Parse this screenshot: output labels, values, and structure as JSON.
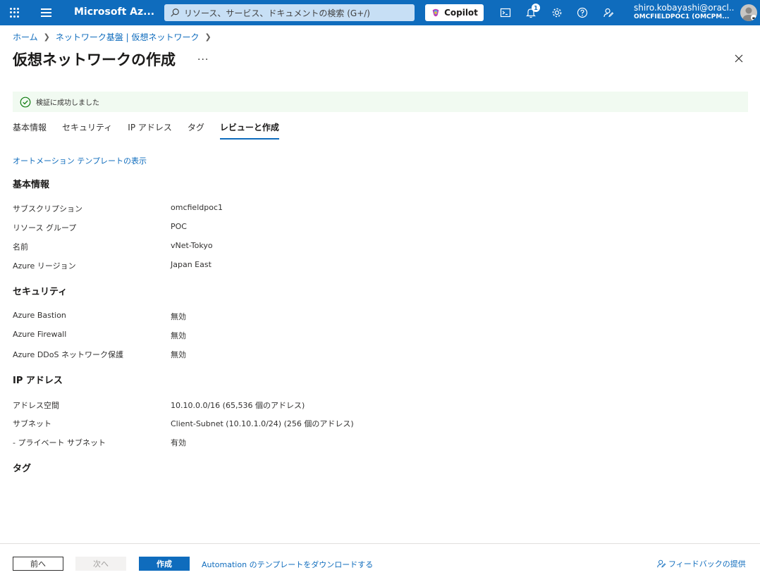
{
  "topbar": {
    "brand": "Microsoft Az...",
    "search_placeholder": "リソース、サービス、ドキュメントの検索 (G+/)",
    "copilot_label": "Copilot",
    "notification_count": "1",
    "account_user": "shiro.kobayashi@oracl...",
    "account_tenant": "OMCFIELDPOC1 (OMCPM...",
    "accent_color": "#0f6cbd"
  },
  "breadcrumb": {
    "home": "ホーム",
    "parent": "ネットワーク基盤 | 仮想ネットワーク"
  },
  "page": {
    "title": "仮想ネットワークの作成",
    "more": "...",
    "banner_text": "検証に成功しました"
  },
  "tabs": [
    {
      "label": "基本情報"
    },
    {
      "label": "セキュリティ"
    },
    {
      "label": "IP アドレス"
    },
    {
      "label": "タグ"
    },
    {
      "label": "レビューと作成"
    }
  ],
  "automation_link": "オートメーション テンプレートの表示",
  "sections": {
    "basics": {
      "title": "基本情報",
      "rows": [
        {
          "label": "サブスクリプション",
          "value": "omcfieldpoc1"
        },
        {
          "label": "リソース グループ",
          "value": "POC"
        },
        {
          "label": "名前",
          "value": "vNet-Tokyo"
        },
        {
          "label": "Azure リージョン",
          "value": "Japan East"
        }
      ]
    },
    "security": {
      "title": "セキュリティ",
      "rows": [
        {
          "label": "Azure Bastion",
          "value": "無効"
        },
        {
          "label": "Azure Firewall",
          "value": "無効"
        },
        {
          "label": "Azure DDoS ネットワーク保護",
          "value": "無効"
        }
      ]
    },
    "ip": {
      "title": "IP アドレス",
      "rows": [
        {
          "label": "アドレス空間",
          "value": "10.10.0.0/16 (65,536 個のアドレス)"
        },
        {
          "label": "サブネット",
          "value": "Client-Subnet (10.10.1.0/24) (256 個のアドレス)"
        },
        {
          "label": "- プライベート サブネット",
          "value": "有効"
        }
      ]
    },
    "tags": {
      "title": "タグ"
    }
  },
  "footer": {
    "prev": "前へ",
    "next": "次へ",
    "create": "作成",
    "download_link": "Automation のテンプレートをダウンロードする",
    "feedback": "フィードバックの提供"
  }
}
